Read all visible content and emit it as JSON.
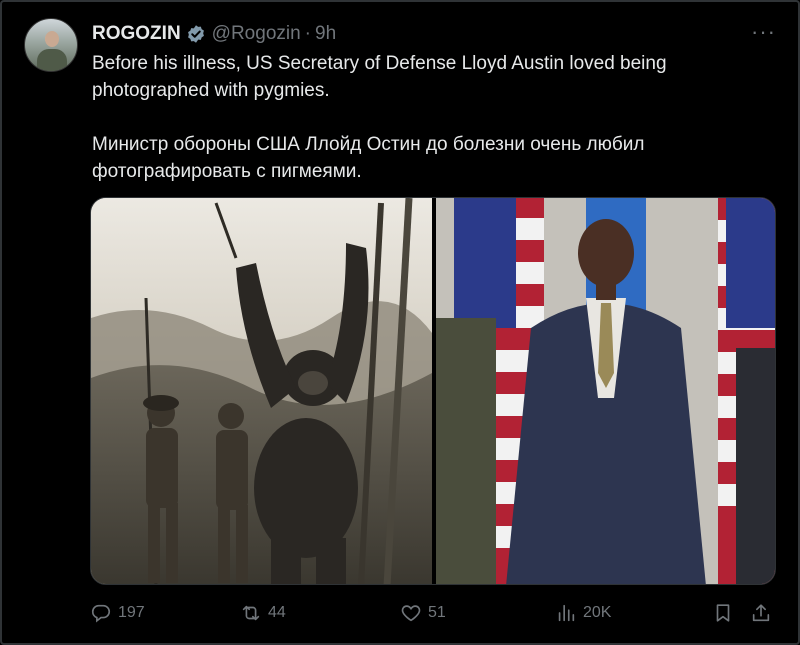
{
  "author": {
    "name": "ROGOZIN",
    "handle": "@Rogozin",
    "separator": "·",
    "time": "9h",
    "verified": true,
    "avatar_icon": "profile-photo"
  },
  "tweet": {
    "text_en": "Before his illness, US Secretary of Defense Lloyd Austin loved being\nphotographed with pygmies.",
    "text_ru": "Министр обороны США Ллойд Остин до болезни очень любил\nфотографировать с пигмеями."
  },
  "media": {
    "left_image": "historical-photo-gorilla-and-pygmies",
    "right_image": "lloyd-austin-with-flags"
  },
  "actions": {
    "replies": "197",
    "reposts": "44",
    "likes": "51",
    "views": "20K"
  },
  "more_label": "···",
  "colors": {
    "background": "#000000",
    "text": "#e7e9ea",
    "muted": "#71767b",
    "verified_badge": "#829aab",
    "border": "#2f3336"
  }
}
